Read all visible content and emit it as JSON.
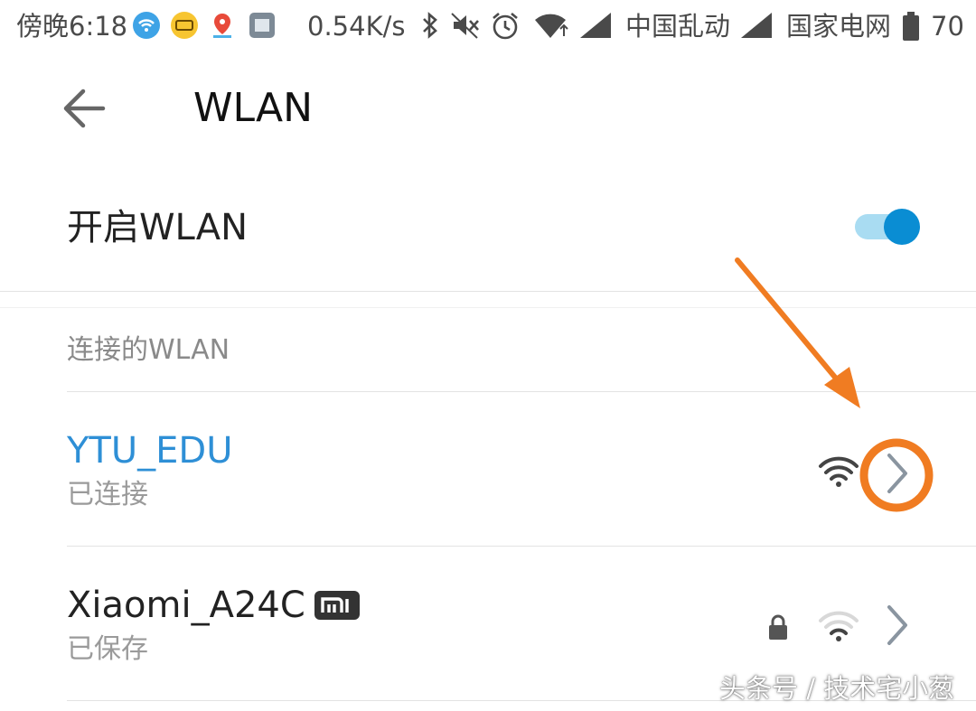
{
  "status_bar": {
    "time": "傍晚6:18",
    "net_speed": "0.54K/s",
    "carrier_1": "中国乱动",
    "carrier_2": "国家电网",
    "battery": "70"
  },
  "header": {
    "title": "WLAN"
  },
  "wlan_toggle": {
    "label": "开启WLAN",
    "enabled": true
  },
  "connected_section": {
    "label": "连接的WLAN"
  },
  "networks": [
    {
      "name": "YTU_EDU",
      "status": "已连接",
      "locked": false,
      "connected": true
    },
    {
      "name": "Xiaomi_A24C",
      "status": "已保存",
      "locked": true,
      "connected": false
    }
  ],
  "colors": {
    "accent": "#2e8fd6",
    "toggle_on": "#0a8dd3",
    "annotation": "#f07c22"
  },
  "watermark": "头条号 / 技术宅小葱"
}
